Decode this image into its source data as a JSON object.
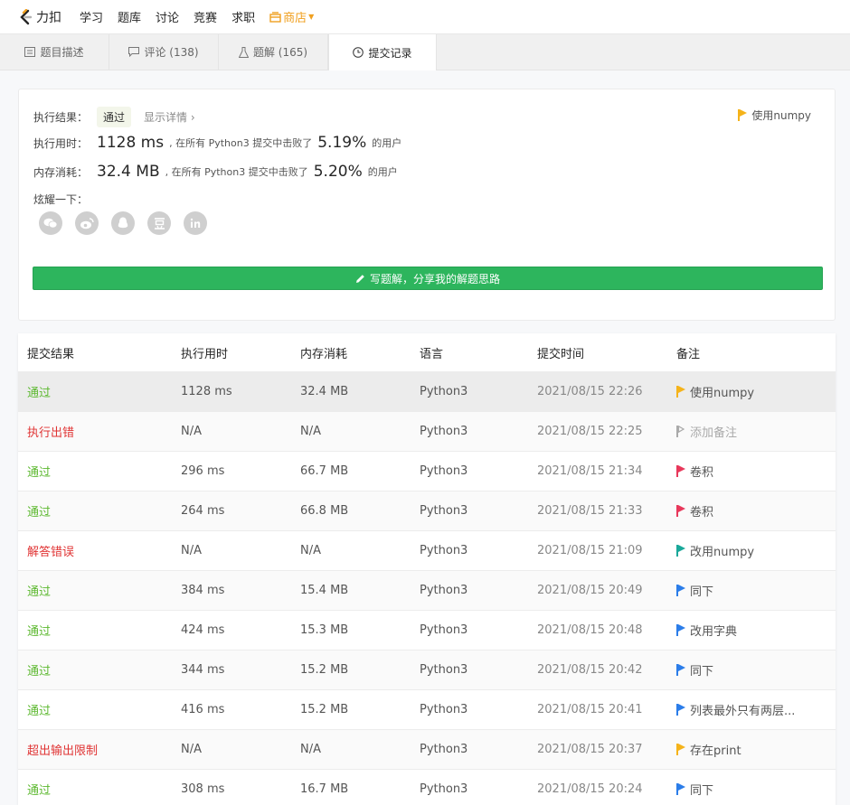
{
  "nav": {
    "logo_text": "力扣",
    "items": [
      "学习",
      "题库",
      "讨论",
      "竞赛",
      "求职"
    ],
    "store": "商店"
  },
  "tabs": [
    {
      "label": "题目描述",
      "icon": "description-icon"
    },
    {
      "label": "评论 (138)",
      "icon": "comment-icon"
    },
    {
      "label": "题解 (165)",
      "icon": "flask-icon"
    },
    {
      "label": "提交记录",
      "icon": "clock-icon",
      "active": true
    }
  ],
  "result": {
    "label_result": "执行结果：",
    "status": "通过",
    "detail_link": "显示详情 ›",
    "label_time": "执行用时：",
    "time_value": "1128 ms",
    "time_text1": ", 在所有 Python3 提交中击败了",
    "time_pct": "5.19%",
    "time_text2": "的用户",
    "label_mem": "内存消耗：",
    "mem_value": "32.4 MB",
    "mem_text1": ", 在所有 Python3 提交中击败了",
    "mem_pct": "5.20%",
    "mem_text2": "的用户",
    "share_label": "炫耀一下：",
    "note": "使用numpy",
    "share_button": "写题解，分享我的解题思路"
  },
  "table": {
    "headers": [
      "提交结果",
      "执行用时",
      "内存消耗",
      "语言",
      "提交时间",
      "备注"
    ],
    "rows": [
      {
        "status": "通过",
        "time": "1128 ms",
        "mem": "32.4 MB",
        "lang": "Python3",
        "date": "2021/08/15 22:26",
        "note": "使用numpy"
      },
      {
        "status": "执行出错",
        "time": "N/A",
        "mem": "N/A",
        "lang": "Python3",
        "date": "2021/08/15 22:25",
        "note": "添加备注"
      },
      {
        "status": "通过",
        "time": "296 ms",
        "mem": "66.7 MB",
        "lang": "Python3",
        "date": "2021/08/15 21:34",
        "note": "卷积"
      },
      {
        "status": "通过",
        "time": "264 ms",
        "mem": "66.8 MB",
        "lang": "Python3",
        "date": "2021/08/15 21:33",
        "note": "卷积"
      },
      {
        "status": "解答错误",
        "time": "N/A",
        "mem": "N/A",
        "lang": "Python3",
        "date": "2021/08/15 21:09",
        "note": "改用numpy"
      },
      {
        "status": "通过",
        "time": "384 ms",
        "mem": "15.4 MB",
        "lang": "Python3",
        "date": "2021/08/15 20:49",
        "note": "同下"
      },
      {
        "status": "通过",
        "time": "424 ms",
        "mem": "15.3 MB",
        "lang": "Python3",
        "date": "2021/08/15 20:48",
        "note": "改用字典"
      },
      {
        "status": "通过",
        "time": "344 ms",
        "mem": "15.2 MB",
        "lang": "Python3",
        "date": "2021/08/15 20:42",
        "note": "同下"
      },
      {
        "status": "通过",
        "time": "416 ms",
        "mem": "15.2 MB",
        "lang": "Python3",
        "date": "2021/08/15 20:41",
        "note": "列表最外只有两层..."
      },
      {
        "status": "超出输出限制",
        "time": "N/A",
        "mem": "N/A",
        "lang": "Python3",
        "date": "2021/08/15 20:37",
        "note": "存在print"
      },
      {
        "status": "通过",
        "time": "308 ms",
        "mem": "16.7 MB",
        "lang": "Python3",
        "date": "2021/08/15 20:24",
        "note": "同下"
      }
    ]
  },
  "colors": {
    "pass": "#5cb82f",
    "error": "#e03434",
    "flag_yellow": "#f5b31a",
    "flag_red": "#e8385b",
    "flag_teal": "#1aa89a",
    "flag_blue": "#2b7de9",
    "flag_gray": "#aaaaaa"
  }
}
